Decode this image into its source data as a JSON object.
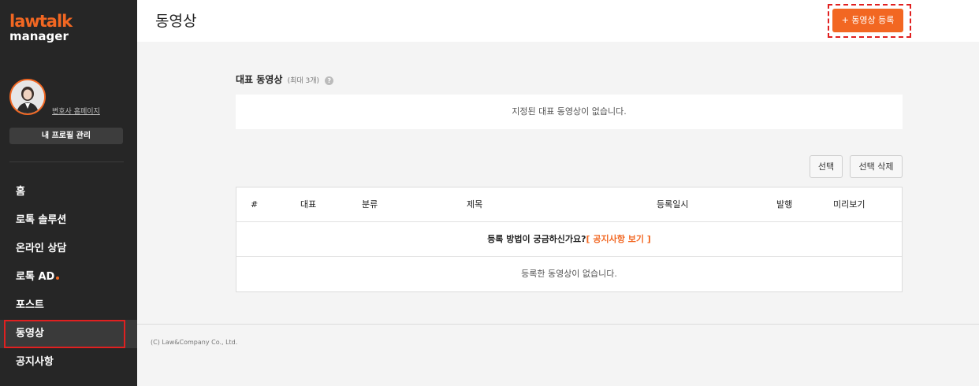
{
  "brand": {
    "logo_top": "lawtalk",
    "logo_bottom": "manager"
  },
  "sidebar": {
    "homepage_link": "변호사 홈페이지",
    "profile_button": "내 프로필 관리",
    "items": [
      {
        "label": "홈",
        "active": false
      },
      {
        "label": "로톡 솔루션",
        "active": false
      },
      {
        "label": "온라인 상담",
        "active": false
      },
      {
        "label": "로톡 AD",
        "active": false,
        "dot": true
      },
      {
        "label": "포스트",
        "active": false
      },
      {
        "label": "동영상",
        "active": true
      },
      {
        "label": "공지사항",
        "active": false
      }
    ]
  },
  "header": {
    "title": "동영상",
    "register_button": "+ 동영상 등록"
  },
  "representative": {
    "title": "대표 동영상",
    "subtitle": "(최대 3개)",
    "empty_text": "지정된 대표 동영상이 없습니다."
  },
  "actions": {
    "select_label": "선택",
    "delete_label": "선택 삭제"
  },
  "table": {
    "columns": [
      "#",
      "대표",
      "분류",
      "제목",
      "등록일시",
      "발행",
      "미리보기"
    ],
    "notice_text": "등록 방법이 궁금하신가요?",
    "notice_link": "[ 공지사항 보기 ]",
    "empty_text": "등록한 동영상이 없습니다."
  },
  "footer": {
    "copyright": "(C) Law&Company Co., Ltd."
  },
  "colors": {
    "accent": "#f26722",
    "sidebar_bg": "#262626",
    "highlight": "#e02020"
  }
}
